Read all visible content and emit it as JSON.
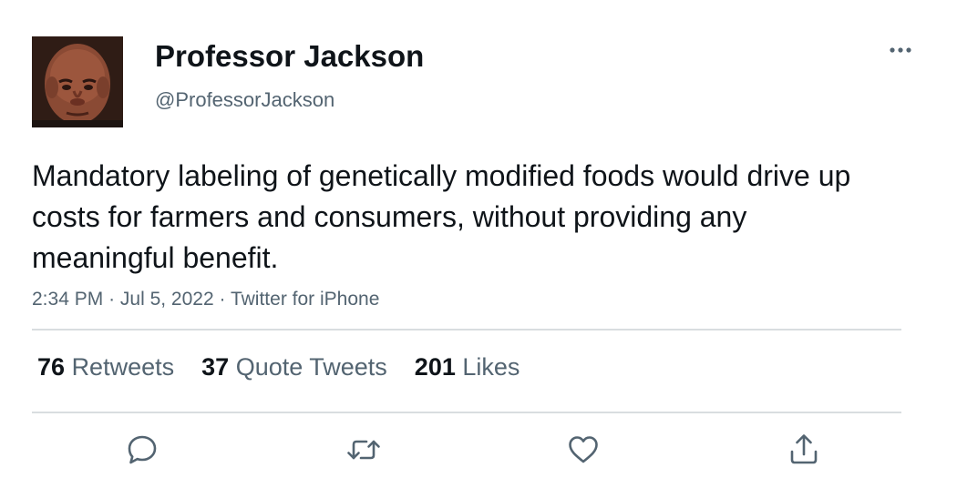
{
  "tweet": {
    "author": {
      "display_name": "Professor Jackson",
      "handle": "@ProfessorJackson"
    },
    "text": "Mandatory labeling of genetically modified foods would drive up costs for farmers and consumers, without providing any meaningful benefit.",
    "meta": {
      "time": "2:34 PM",
      "separator": "·",
      "date": "Jul 5, 2022",
      "source": "Twitter for iPhone"
    },
    "stats": {
      "retweets_count": "76",
      "retweets_label": "Retweets",
      "quotes_count": "37",
      "quotes_label": "Quote Tweets",
      "likes_count": "201",
      "likes_label": "Likes"
    },
    "icons": {
      "more": "more-horizontal-icon",
      "reply": "reply-icon",
      "retweet": "retweet-icon",
      "like": "heart-icon",
      "share": "share-icon"
    },
    "colors": {
      "text_primary": "#0f1419",
      "text_secondary": "#536471",
      "divider": "#d9dde0"
    }
  }
}
